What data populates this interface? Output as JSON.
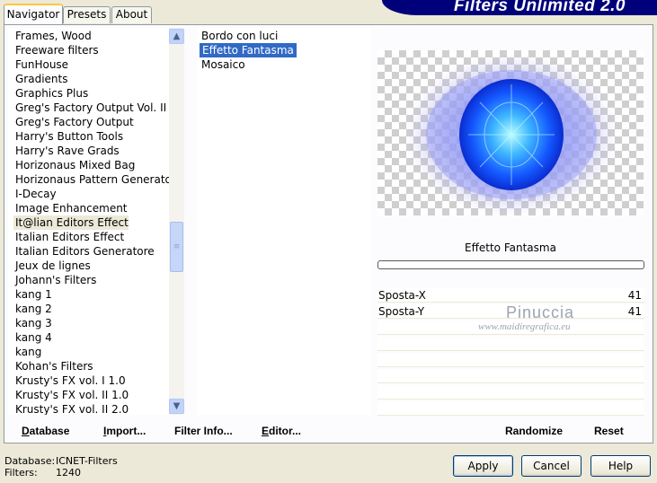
{
  "title": "Filters Unlimited 2.0",
  "tabs": [
    "Navigator",
    "Presets",
    "About"
  ],
  "categories": [
    "Frames, Wood",
    "Freeware filters",
    "FunHouse",
    "Gradients",
    "Graphics Plus",
    "Greg's Factory Output Vol. II",
    "Greg's Factory Output",
    "Harry's Button Tools",
    "Harry's Rave Grads",
    "Horizonaus Mixed Bag",
    "Horizonaus Pattern Generators",
    "I-Decay",
    "Image Enhancement",
    "It@lian Editors Effect",
    "Italian Editors Effect",
    "Italian Editors Generatore",
    "Jeux de lignes",
    "Johann's Filters",
    "kang 1",
    "kang 2",
    "kang 3",
    "kang 4",
    "kang",
    "Kohan's Filters",
    "Krusty's FX vol. I 1.0",
    "Krusty's FX vol. II 1.0",
    "Krusty's FX vol. II 2.0"
  ],
  "selected_category": "It@lian Editors Effect",
  "filters": [
    "Bordo con luci",
    "Effetto Fantasma",
    "Mosaico"
  ],
  "selected_filter": "Effetto Fantasma",
  "left_buttons": {
    "database": "Database",
    "import": "Import...",
    "filter_info": "Filter Info...",
    "editor": "Editor..."
  },
  "filter_name": "Effetto Fantasma",
  "params": [
    {
      "label": "Sposta-X",
      "value": "41"
    },
    {
      "label": "Sposta-Y",
      "value": "41"
    }
  ],
  "right_buttons": {
    "randomize": "Randomize",
    "reset": "Reset"
  },
  "watermark": {
    "name": "Pinuccia",
    "url": "www.maidiregrafica.eu"
  },
  "status": {
    "database_label": "Database:",
    "database_value": "ICNET-Filters",
    "filters_label": "Filters:",
    "filters_value": "1240"
  },
  "dialog_buttons": {
    "apply": "Apply",
    "cancel": "Cancel",
    "help": "Help"
  },
  "icons": {
    "scroll_up": "chevron-up-icon",
    "scroll_down": "chevron-down-icon",
    "scroll_grip": "grip-icon"
  },
  "colors": {
    "banner": "#00007a",
    "selection": "#316ac5",
    "window": "#ece9d8",
    "tab_highlight": "#ffc83c"
  }
}
